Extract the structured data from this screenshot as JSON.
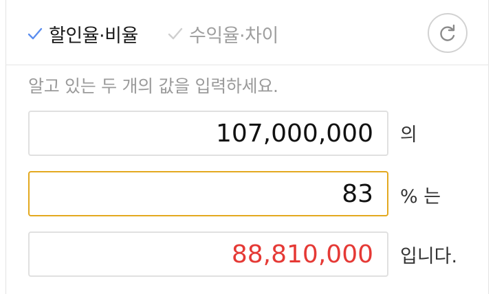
{
  "tabs": [
    {
      "label": "할인율·비율",
      "active": true
    },
    {
      "label": "수익율·차이",
      "active": false
    }
  ],
  "instruction": "알고 있는 두 개의 값을 입력하세요.",
  "fields": [
    {
      "value": "107,000,000",
      "suffix": "의"
    },
    {
      "value": "83",
      "suffix": "% 는",
      "focused": true
    },
    {
      "value": "88,810,000",
      "suffix": "입니다.",
      "result": true
    }
  ],
  "icons": {
    "check": "check-icon",
    "reset": "refresh-icon"
  },
  "colors": {
    "accent": "#5b8def",
    "focus_border": "#e3a81e",
    "result_text": "#e53935",
    "muted": "#9e9e9e"
  }
}
